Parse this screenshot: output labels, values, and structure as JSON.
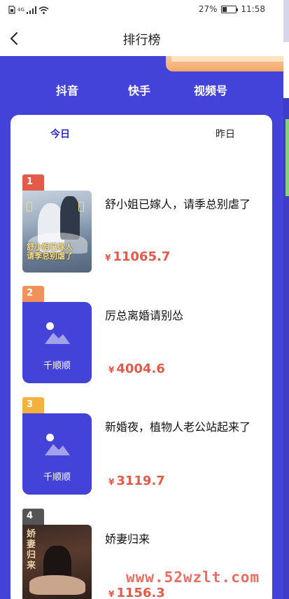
{
  "status_bar": {
    "network": "4G",
    "battery": "27%",
    "time": "11:58"
  },
  "header": {
    "title": "排行榜"
  },
  "platform_tabs": [
    "抖音",
    "快手",
    "视频号"
  ],
  "day_tabs": {
    "today": "今日",
    "yesterday": "昨日"
  },
  "ranking": [
    {
      "rank": "1",
      "title": "舒小姐已嫁人，请季总别虐了",
      "currency": "¥",
      "amount": "11065.7",
      "cover": "poster",
      "poster_text": "舒小姐已嫁人\n请季总别虐了"
    },
    {
      "rank": "2",
      "title": "厉总离婚请别怂",
      "currency": "¥",
      "amount": "4004.6",
      "cover": "placeholder",
      "placeholder_label": "千顺顺"
    },
    {
      "rank": "3",
      "title": "新婚夜，植物人老公站起来了",
      "currency": "¥",
      "amount": "3119.7",
      "cover": "placeholder",
      "placeholder_label": "千顺顺"
    },
    {
      "rank": "4",
      "title": "娇妻归来",
      "currency": "¥",
      "amount": "1156.3",
      "cover": "poster",
      "poster_text": "娇妻归来"
    }
  ],
  "colors": {
    "brand_blue": "#4343d9",
    "price_red": "#e25a4a",
    "rank1": "#e25a4a",
    "rank2": "#f0935a",
    "rank3": "#f3b23e",
    "rank4": "#555555"
  },
  "watermark": "www.52wzlt.com"
}
